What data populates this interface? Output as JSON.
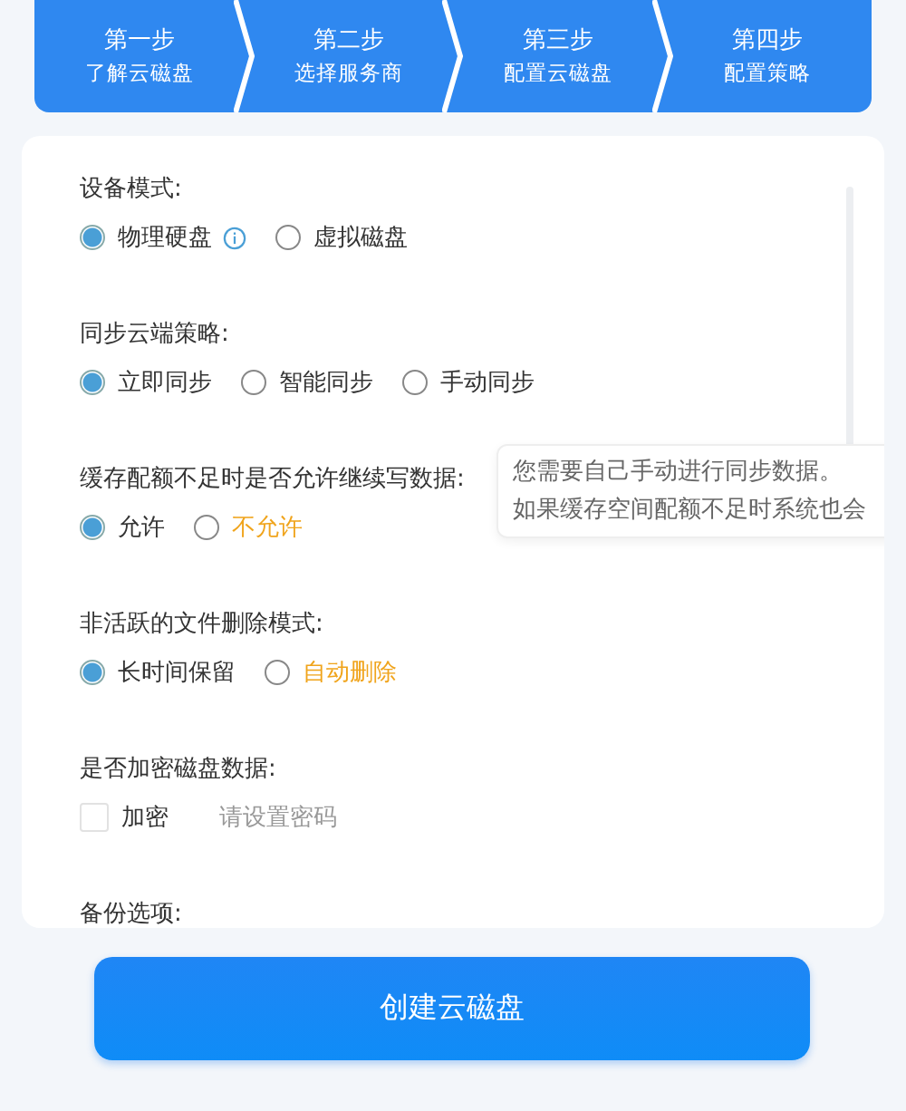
{
  "steps": [
    {
      "title": "第一步",
      "subtitle": "了解云磁盘"
    },
    {
      "title": "第二步",
      "subtitle": "选择服务商"
    },
    {
      "title": "第三步",
      "subtitle": "配置云磁盘"
    },
    {
      "title": "第四步",
      "subtitle": "配置策略"
    }
  ],
  "sections": [
    {
      "kind": "radio",
      "label": "设备模式:",
      "options": [
        {
          "label": "物理硬盘",
          "selected": true,
          "info": true,
          "color": "#333333"
        },
        {
          "label": "虚拟磁盘",
          "selected": false,
          "info": false,
          "color": "#333333"
        }
      ]
    },
    {
      "kind": "radio",
      "label": "同步云端策略:",
      "options": [
        {
          "label": "立即同步",
          "selected": true,
          "info": false,
          "color": "#333333"
        },
        {
          "label": "智能同步",
          "selected": false,
          "info": false,
          "color": "#333333"
        },
        {
          "label": "手动同步",
          "selected": false,
          "info": false,
          "color": "#333333"
        }
      ]
    },
    {
      "kind": "radio",
      "label": "缓存配额不足时是否允许继续写数据:",
      "options": [
        {
          "label": "允许",
          "selected": true,
          "info": false,
          "color": "#333333"
        },
        {
          "label": "不允许",
          "selected": false,
          "info": false,
          "color": "#f0a41c"
        }
      ]
    },
    {
      "kind": "radio",
      "label": "非活跃的文件删除模式:",
      "options": [
        {
          "label": "长时间保留",
          "selected": true,
          "info": false,
          "color": "#333333"
        },
        {
          "label": "自动删除",
          "selected": false,
          "info": false,
          "color": "#f0a41c"
        }
      ]
    },
    {
      "kind": "checkbox",
      "label": "是否加密磁盘数据:",
      "checkbox": {
        "label": "加密",
        "checked": false
      },
      "password": {
        "placeholder": "请设置密码"
      }
    },
    {
      "kind": "heading",
      "label": "备份选项:"
    }
  ],
  "tooltip": {
    "lines": [
      "您需要自己手动进行同步数据。",
      "如果缓存空间配额不足时系统也会"
    ]
  },
  "create_button": "创建云磁盘"
}
